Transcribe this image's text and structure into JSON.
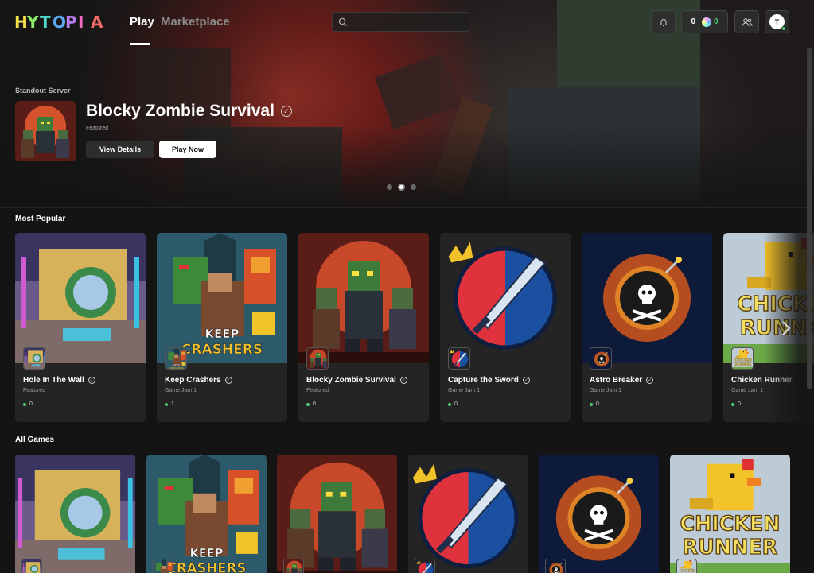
{
  "app": {
    "logo_text": "HYTOPIA"
  },
  "nav": {
    "tabs": [
      {
        "label": "Play",
        "active": true
      },
      {
        "label": "Marketplace",
        "active": false
      }
    ]
  },
  "search": {
    "placeholder": ""
  },
  "header": {
    "coins": "0",
    "gems": "0",
    "avatar_initial": "T"
  },
  "hero": {
    "label": "Standout Server",
    "title": "Blocky Zombie Survival",
    "subtitle": "Featured",
    "details_button": "View Details",
    "play_button": "Play Now",
    "carousel": {
      "count": 3,
      "active_index": 1
    }
  },
  "most_popular": {
    "title": "Most Popular",
    "cards": [
      {
        "name": "Hole In The Wall",
        "sub": "Featured",
        "players": "0",
        "verified": true,
        "art": "hole"
      },
      {
        "name": "Keep Crashers",
        "sub": "Game Jam 1",
        "players": "1",
        "verified": true,
        "art": "keep"
      },
      {
        "name": "Blocky Zombie Survival",
        "sub": "Featured",
        "players": "0",
        "verified": true,
        "art": "zombie"
      },
      {
        "name": "Capture the Sword",
        "sub": "Game Jam 1",
        "players": "0",
        "verified": true,
        "art": "sword"
      },
      {
        "name": "Astro Breaker",
        "sub": "Game Jam 1",
        "players": "0",
        "verified": true,
        "art": "astro"
      },
      {
        "name": "Chicken Runner",
        "sub": "Game Jam 1",
        "players": "0",
        "verified": false,
        "art": "chicken"
      }
    ]
  },
  "all_games": {
    "title": "All Games",
    "cards": [
      {
        "art": "hole"
      },
      {
        "art": "keep"
      },
      {
        "art": "zombie"
      },
      {
        "art": "sword"
      },
      {
        "art": "astro"
      },
      {
        "art": "chicken"
      }
    ]
  },
  "art_text": {
    "keep": "KEEP CRASHERS",
    "chicken": "CHICKEN RUNNER"
  },
  "colors": {
    "accent_green": "#4ecb71",
    "background": "#141414",
    "card": "#242424"
  }
}
